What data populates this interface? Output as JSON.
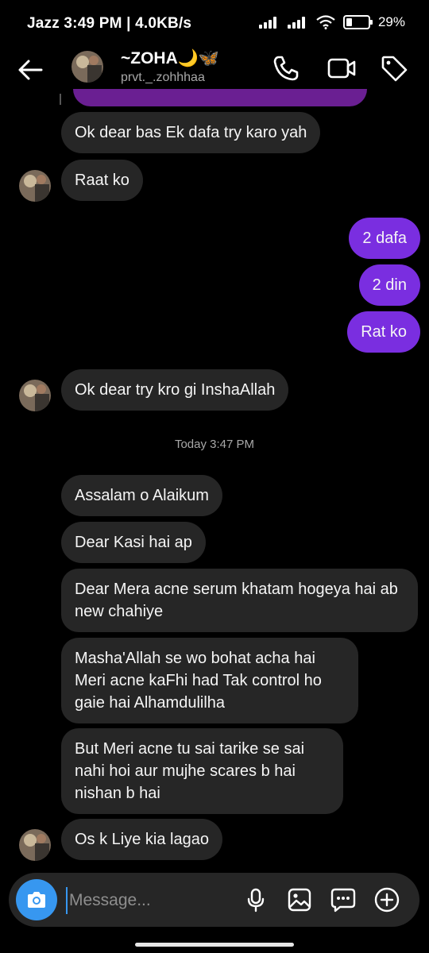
{
  "status": {
    "carrier_time_speed": "Jazz 3:49 PM | 4.0KB/s",
    "battery": "29%"
  },
  "header": {
    "name": "~ZOHA🌙🦋",
    "username": "prvt._.zohhhaa"
  },
  "messages": {
    "m1": "Ok dear bas Ek dafa try karo yah",
    "m2": "Raat ko",
    "m3": "2 dafa",
    "m4": "2 din",
    "m5": "Rat ko",
    "m6": "Ok dear try kro gi InshaAllah",
    "timestamp": "Today 3:47 PM",
    "m7": "Assalam o Alaikum",
    "m8": "Dear Kasi hai ap",
    "m9": "Dear Mera acne serum khatam hogeya hai ab new chahiye",
    "m10": "Masha'Allah se wo bohat acha hai Meri acne kaFhi had Tak control ho gaie hai Alhamdulilha",
    "m11": "But Meri acne tu sai tarike se sai nahi hoi aur mujhe scares b hai nishan b hai",
    "m12": "Os k Liye kia lagao"
  },
  "composer": {
    "placeholder": "Message..."
  },
  "colors": {
    "incoming_bubble": "#262626",
    "outgoing_bubble": "#7a2ee0",
    "camera_button": "#3797f0"
  }
}
